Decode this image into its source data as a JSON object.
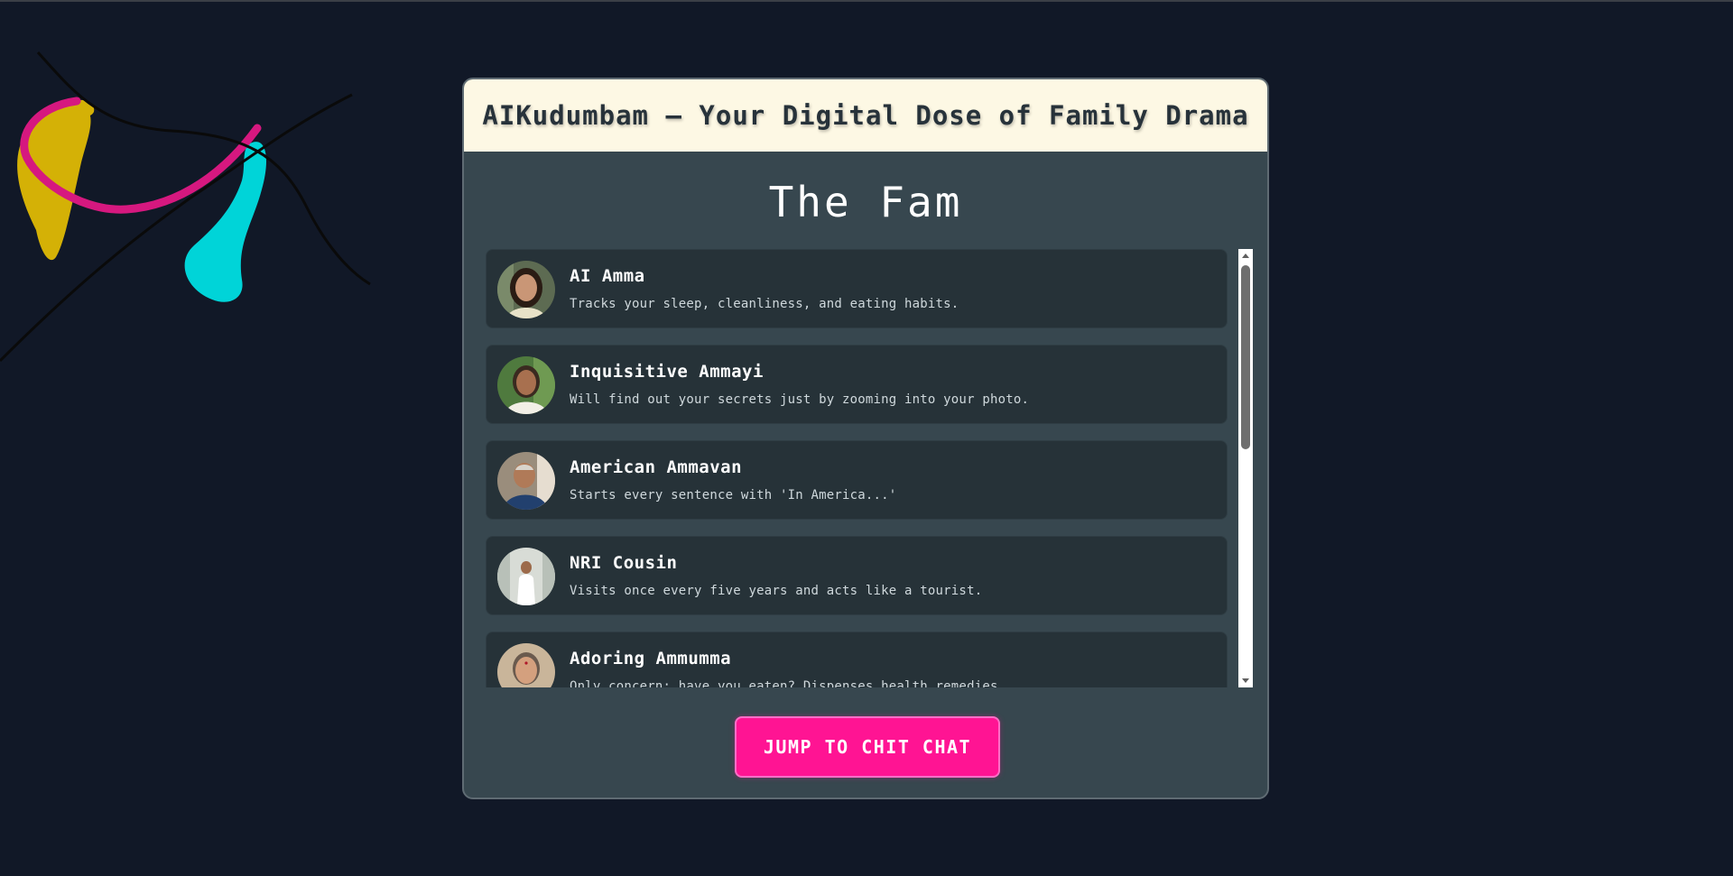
{
  "header": {
    "title": "AIKudumbam – Your Digital Dose of Family Drama"
  },
  "section": {
    "title": "The Fam"
  },
  "characters": [
    {
      "name": "AI Amma",
      "description": "Tracks your sleep, cleanliness, and eating habits.",
      "avatar": "woman-portrait"
    },
    {
      "name": "Inquisitive Ammayi",
      "description": "Will find out your secrets just by zooming into your photo.",
      "avatar": "woman-portrait"
    },
    {
      "name": "American Ammavan",
      "description": "Starts every sentence with 'In America...'",
      "avatar": "man-portrait"
    },
    {
      "name": "NRI Cousin",
      "description": "Visits once every five years and acts like a tourist.",
      "avatar": "man-portrait"
    },
    {
      "name": "Adoring Ammumma",
      "description": "Only concern: have you eaten? Dispenses health remedies.",
      "avatar": "woman-portrait"
    }
  ],
  "cta": {
    "label": "JUMP TO CHIT CHAT"
  },
  "colors": {
    "background": "#111827",
    "panel": "#37474f",
    "header": "#fdf8e4",
    "card": "#263238",
    "accent": "#ff1493"
  }
}
